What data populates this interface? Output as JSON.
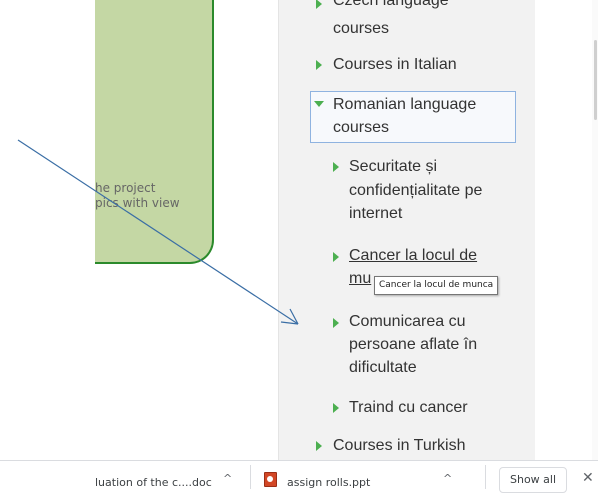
{
  "card": {
    "text_line1": "he project",
    "text_line2": "pics with view"
  },
  "nav": {
    "item_czech_partial": "Czech language",
    "item_czech_line2": "courses",
    "item_italian": "Courses in Italian",
    "item_romanian_line1": "Romanian language",
    "item_romanian_line2": "courses",
    "sub_security_line1": "Securitate și",
    "sub_security_line2": "confidențialitate pe",
    "sub_security_line3": "internet",
    "sub_cancer_line1": "Cancer la locul de",
    "sub_cancer_line2": "mu",
    "tooltip": "Cancer la locul de munca",
    "sub_comm_line1": "Comunicarea cu",
    "sub_comm_line2": "persoane aflate în",
    "sub_comm_line3": "dificultate",
    "sub_traind": "Traind cu cancer",
    "item_turkish": "Courses in Turkish"
  },
  "downloads": {
    "file1": "luation of the c....doc",
    "file2": "assign rolls.ppt",
    "show_all": "Show all",
    "chevron": "^",
    "close": "✕"
  },
  "icons": {
    "expand": "triangle-right-icon",
    "collapse": "triangle-down-icon",
    "ppt": "ppt-file-icon",
    "close": "close-icon"
  },
  "colors": {
    "card_fill": "#c4d7a4",
    "card_border": "#2b8a2b",
    "nav_bg": "#f2f2f2",
    "triangle": "#4caf50",
    "arrow": "#3a6ea5",
    "selected_border": "#8fb3e0"
  }
}
